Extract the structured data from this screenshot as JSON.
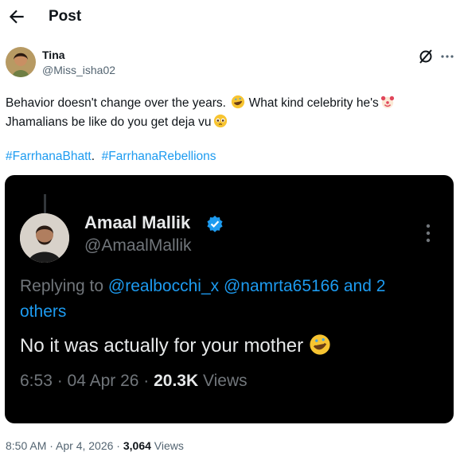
{
  "header": {
    "title": "Post"
  },
  "author": {
    "name": "Tina",
    "handle": "@Miss_isha02"
  },
  "tweet": {
    "line1": "Behavior doesn't change over the years. ",
    "line1b": " What kind celebrity he's",
    "line2": "Jhamalians be like do you get deja vu",
    "emoji_1": "rolling-on-floor-laughing",
    "emoji_2": "clown-face",
    "emoji_3": "pleading-face",
    "hashtags": [
      "#FarrhanaBhatt",
      "#FarrhanaRebellions"
    ],
    "hashtag_sep": "."
  },
  "embedded": {
    "name": "Amaal Mallik",
    "handle": "@AmaalMallik",
    "verified": true,
    "replying_prefix": "Replying to ",
    "replying_handles": "@realbocchi_x @namrta65166",
    "replying_and": " and 2",
    "replying_others": "others",
    "body": "No it was actually for your mother ",
    "time": "6:53 · 04 Apr 26 · ",
    "views_count": "20.3K",
    "views_label": " Views"
  },
  "footer": {
    "time": "8:50 AM · Apr 4, 2026 · ",
    "views": "3,064",
    "views_label": " Views"
  },
  "colors": {
    "link": "#1d9bf0",
    "text": "#0f1419",
    "muted": "#536471",
    "emoji": "#f7c431"
  }
}
